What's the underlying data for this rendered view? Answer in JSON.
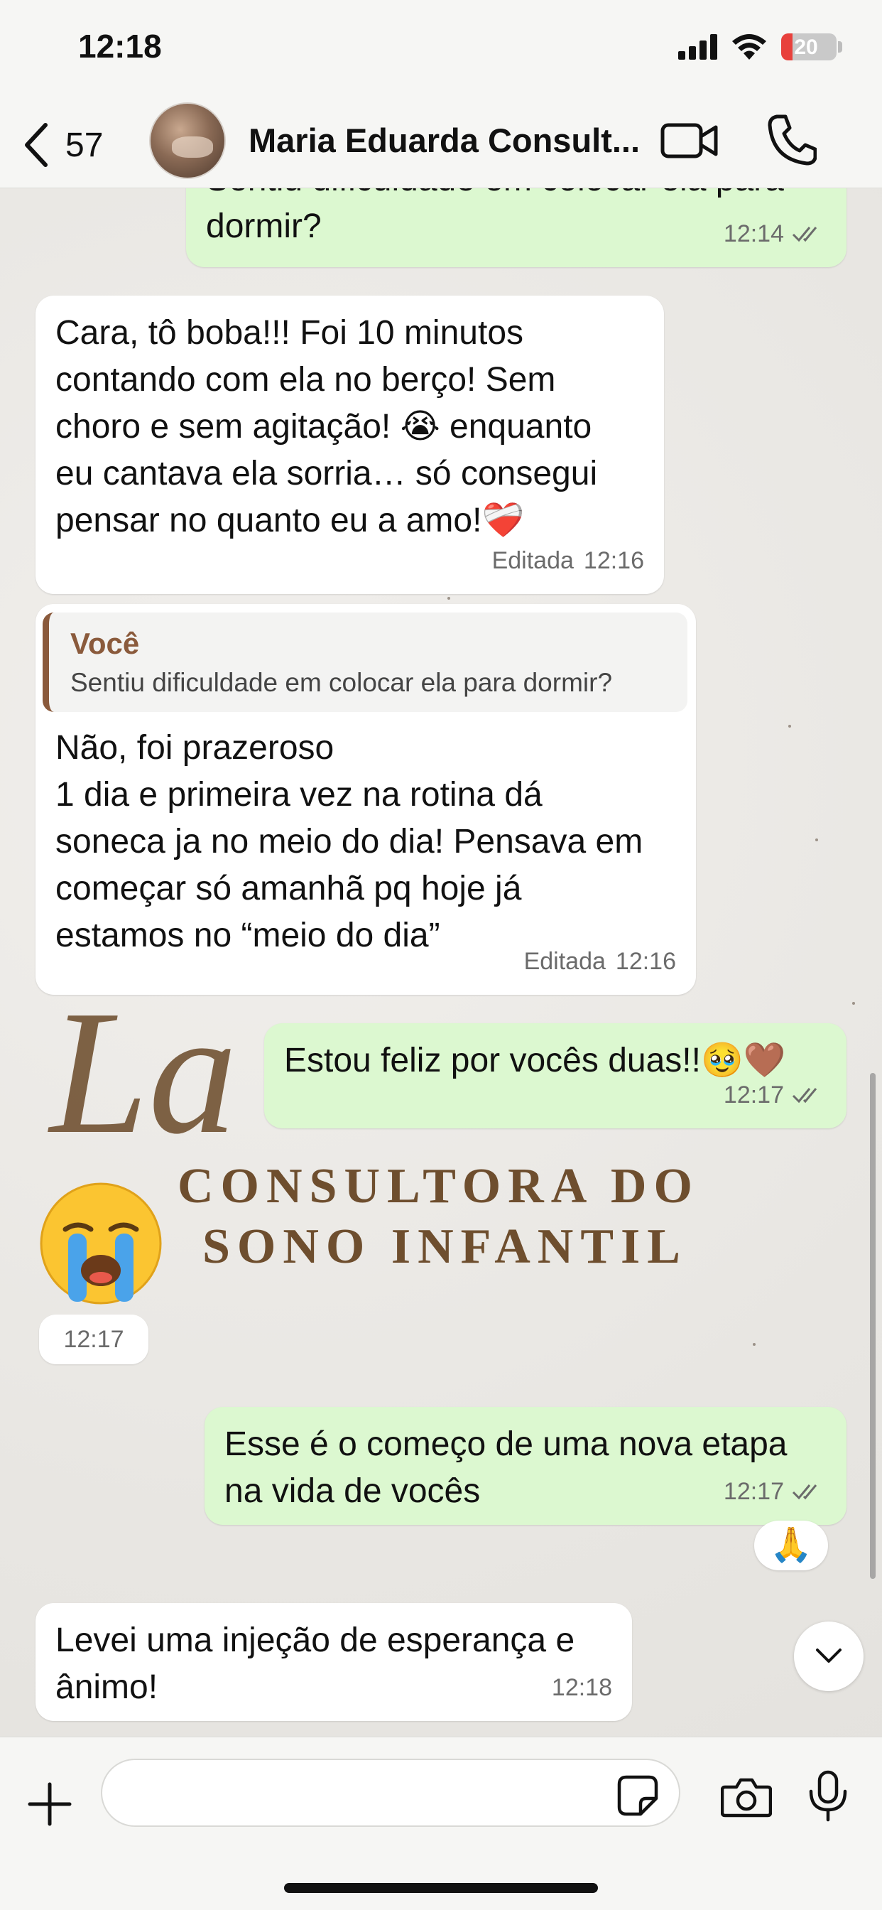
{
  "status_bar": {
    "time": "12:18",
    "battery_level": "20",
    "battery_percent": 20
  },
  "header": {
    "back_count": "57",
    "contact_name": "Maria Eduarda Consult..."
  },
  "messages": [
    {
      "direction": "out",
      "text": "Sentiu dificuldade em colocar ela para\ndormir?",
      "time": "12:14",
      "read": true
    },
    {
      "direction": "in",
      "text": "Cara, tô boba!!! Foi 10 minutos\ncontando com ela no berço! Sem\nchoro e sem agitação! 😭 enquanto\neu cantava ela sorria… só consegui\npensar no quanto eu a amo!❤️‍🩹",
      "edited_label": "Editada",
      "time": "12:16"
    },
    {
      "direction": "in",
      "quote_author": "Você",
      "quote_text": "Sentiu dificuldade em colocar ela para dormir?",
      "text": "Não, foi prazeroso\n1 dia e primeira vez na rotina dá\nsoneca ja no meio do dia! Pensava em\ncomeçar só amanhã pq hoje já\nestamos no “meio do dia”",
      "edited_label": "Editada",
      "time": "12:16"
    },
    {
      "direction": "out",
      "text": "Estou feliz por vocês duas!!🥹🤎",
      "time": "12:17",
      "read": true
    },
    {
      "direction": "in",
      "emoji": "😭",
      "time": "12:17"
    },
    {
      "direction": "out",
      "text": "Esse é o começo de uma nova etapa\nna vida de vocês",
      "time": "12:17",
      "read": true,
      "reaction": "🙏"
    },
    {
      "direction": "in",
      "text": "Levei uma injeção de esperança e\nânimo!",
      "time": "12:18"
    }
  ],
  "wallpaper": {
    "script_text": "La",
    "line1": "CONSULTORA DO",
    "line2": "SONO INFANTIL"
  },
  "composer": {
    "placeholder": ""
  },
  "icons": {
    "back": "chevron-left-icon",
    "video": "video-camera-icon",
    "call": "phone-icon",
    "plus": "plus-icon",
    "sticker": "sticker-icon",
    "camera": "camera-icon",
    "mic": "microphone-icon",
    "scroll": "chevron-down-icon",
    "read": "double-check-icon"
  },
  "colors": {
    "incoming_bubble": "#ffffff",
    "outgoing_bubble": "#dcf8d0",
    "quote_accent": "#8a5a3c",
    "read_ticks": "#6b6b6b",
    "battery_low": "#e8413c"
  }
}
